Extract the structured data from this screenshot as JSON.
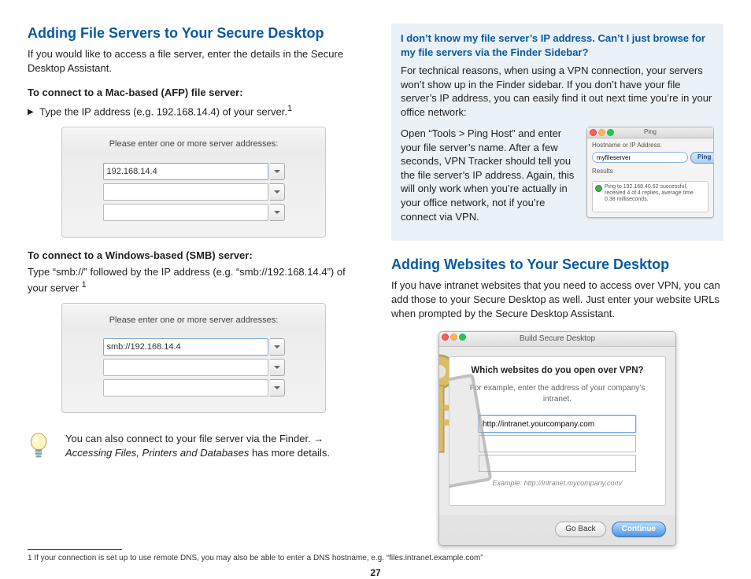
{
  "page_number": "27",
  "left": {
    "heading": "Adding File Servers to Your Secure Desktop",
    "intro": "If you would like to access a file server, enter the details in the Secure Desktop Assistant.",
    "afp_head": "To connect to a Mac-based (AFP) file server:",
    "afp_step": "Type the IP address (e.g. 192.168.14.4) of your server.",
    "afp_sup": "1",
    "panel_label": "Please enter one or more server addresses:",
    "afp_input_value": "192.168.14.4",
    "smb_head": "To connect to a Windows-based (SMB) server:",
    "smb_para_a": "Type “smb://” followed by the IP address (e.g. “smb://192.168.14.4”) of your server ",
    "smb_sup": "1",
    "smb_input_value": "smb://192.168.14.4",
    "tip_a": "You can also connect to your file server via the Finder. → ",
    "tip_b": "Accessing Files, Printers and Databases",
    "tip_c": " has more details.",
    "footnote": "1 If your connection is set up to use remote DNS, you may also be able to enter a DNS hostname, e.g. “files.intranet.example.com”"
  },
  "right": {
    "callout_title": "I don’t know my file server’s IP address. Can’t I just browse for my file servers via the Finder Sidebar?",
    "callout_p1": "For technical reasons, when using a VPN connection, your servers won’t show up in the Finder sidebar. If you don’t have your file server’s IP address, you can easily find it out next time you’re in your office network:",
    "callout_p2": "Open “Tools > Ping Host” and enter your file server’s name. After a few seconds, VPN Tracker should tell you the file server’s IP address. Again, this will only work when you’re actually in your office network, not if you’re connect via VPN.",
    "ping": {
      "title": "Ping",
      "label": "Hostname or IP Address:",
      "value": "myfileserver",
      "button": "Ping",
      "results_label": "Results",
      "result": "Ping to 192.168.40.62 successful, received 4 of 4 replies, average time 0.38 milliseconds."
    },
    "web_heading": "Adding Websites to Your Secure Desktop",
    "web_para": "If you have intranet websites that you need to access over VPN, you can add those to your Secure Desktop as well. Just enter your website URLs when prompted by the Secure Desktop Assistant.",
    "bsd": {
      "title": "Build Secure Desktop",
      "question": "Which websites do you open over VPN?",
      "hint": "For example, enter the address of your company’s intranet.",
      "field_value": "http://intranet.yourcompany.com",
      "example": "Example: http://intranet.mycompany.com/",
      "back": "Go Back",
      "continue": "Continue"
    }
  }
}
